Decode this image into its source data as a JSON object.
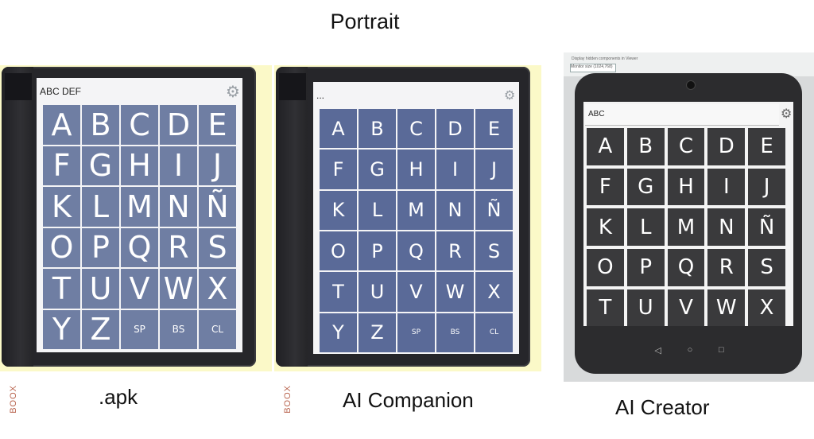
{
  "title": "Portrait",
  "captions": {
    "apk": ".apk",
    "companion": "AI Companion",
    "creator": "AI Creator"
  },
  "devices": {
    "apk": {
      "brand": "BOOX",
      "text": "ABC DEF"
    },
    "companion": {
      "brand": "BOOX",
      "text": "..."
    },
    "creator": {
      "option_checkbox": "Display hidden components in Viewer",
      "size_dropdown": "Monitor size (1024,768)",
      "text": "ABC",
      "nav": [
        "◁",
        "○",
        "□"
      ]
    }
  },
  "keys": [
    "A",
    "B",
    "C",
    "D",
    "E",
    "F",
    "G",
    "H",
    "I",
    "J",
    "K",
    "L",
    "M",
    "N",
    "Ñ",
    "O",
    "P",
    "Q",
    "R",
    "S",
    "T",
    "U",
    "V",
    "W",
    "X",
    "Y",
    "Z",
    "SP",
    "BS",
    "CL"
  ],
  "icons": {
    "settings": "gear-icon"
  },
  "colors": {
    "backdrop": "#fbf9c8",
    "key_apk": "#6f7ea3",
    "key_companion": "#5a6a98",
    "key_creator": "#3a3a3c"
  }
}
